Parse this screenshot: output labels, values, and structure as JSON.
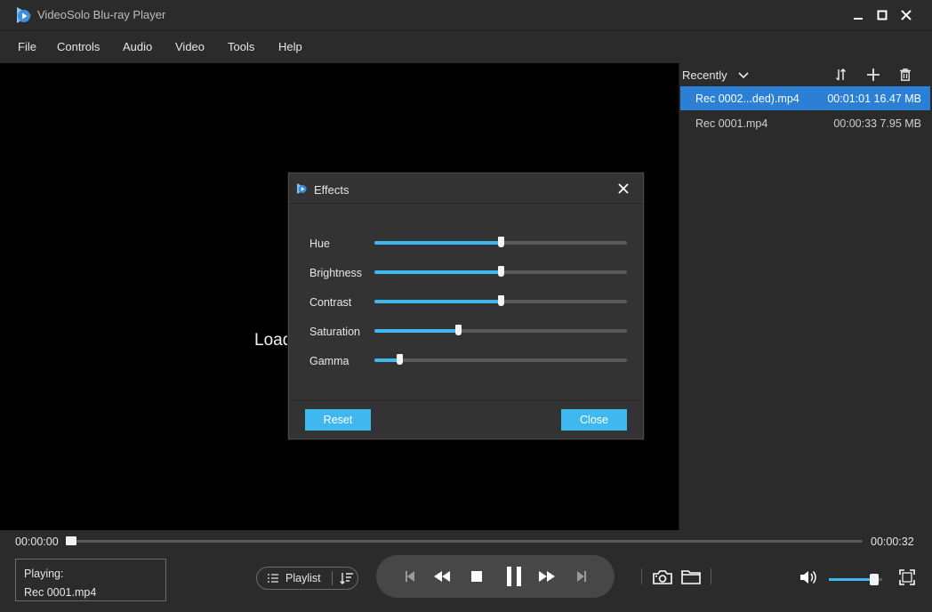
{
  "app": {
    "title": "VideoSolo Blu-ray Player"
  },
  "menu": {
    "items": [
      "File",
      "Controls",
      "Audio",
      "Video",
      "Tools",
      "Help"
    ]
  },
  "video": {
    "loading_text": "Load"
  },
  "playlist": {
    "sort_label": "Recently",
    "items": [
      {
        "name": "Rec 0002...ded).mp4",
        "meta": "00:01:01 16.47 MB",
        "selected": true
      },
      {
        "name": "Rec 0001.mp4",
        "meta": "00:00:33 7.95 MB",
        "selected": false
      }
    ]
  },
  "player": {
    "current_time": "00:00:00",
    "total_time": "00:00:32",
    "progress": 0.0,
    "now_playing_label": "Playing:",
    "now_playing_file": "Rec 0001.mp4",
    "playlist_button": "Playlist",
    "volume": 0.85
  },
  "effects_dialog": {
    "title": "Effects",
    "sliders": [
      {
        "label": "Hue",
        "value": 0.5
      },
      {
        "label": "Brightness",
        "value": 0.5
      },
      {
        "label": "Contrast",
        "value": 0.5
      },
      {
        "label": "Saturation",
        "value": 0.33
      },
      {
        "label": "Gamma",
        "value": 0.1
      }
    ],
    "reset_label": "Reset",
    "close_label": "Close"
  },
  "colors": {
    "accent": "#3fb8f0",
    "selection": "#2b7fd4",
    "background": "#2b2b2b",
    "video": "#000000"
  },
  "icons": [
    "app-logo-icon",
    "minimize-icon",
    "maximize-icon",
    "close-icon",
    "chevron-down-icon",
    "sort-icon",
    "add-icon",
    "trash-icon",
    "list-icon",
    "playlist-order-icon",
    "skip-previous-icon",
    "rewind-icon",
    "stop-icon",
    "pause-icon",
    "fast-forward-icon",
    "skip-next-icon",
    "camera-icon",
    "folder-icon",
    "volume-icon",
    "fullscreen-icon"
  ]
}
